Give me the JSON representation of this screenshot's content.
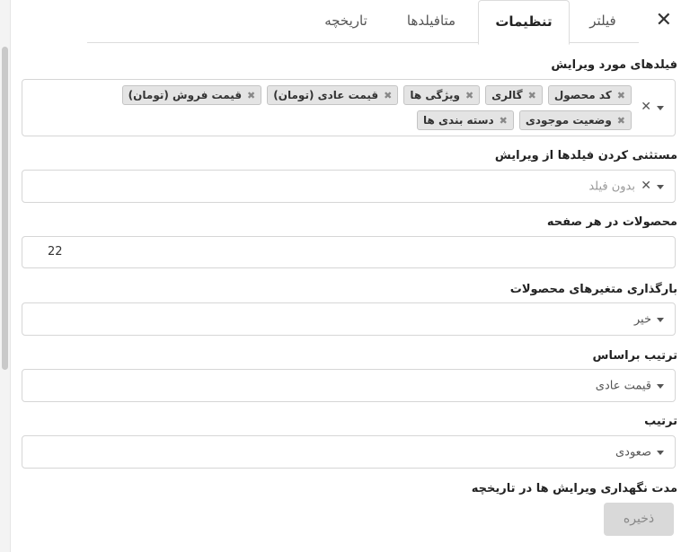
{
  "tabs": [
    {
      "label": "فیلتر"
    },
    {
      "label": "تنظیمات"
    },
    {
      "label": "متافیلدها"
    },
    {
      "label": "تاریخچه"
    }
  ],
  "close_symbol": "✕",
  "fields_to_edit": {
    "label": "فیلدهای مورد ویرایش",
    "chips_row1": [
      "کد محصول",
      "گالری",
      "ویژگی ها",
      "قیمت عادی (تومان)",
      "قیمت فروش (تومان)"
    ],
    "chips_row2": [
      "وضعیت موجودی",
      "دسته بندی ها"
    ],
    "chip_remove": "✖",
    "clear_symbol": "✕"
  },
  "exclude_fields": {
    "label": "مستثنی کردن فیلدها از ویرایش",
    "placeholder": "بدون فیلد",
    "clear_symbol": "✕"
  },
  "products_per_page": {
    "label": "محصولات در هر صفحه",
    "value": "22"
  },
  "load_variations": {
    "label": "بارگذاری متغیرهای محصولات",
    "value": "خیر"
  },
  "sort_by": {
    "label": "ترتیب براساس",
    "value": "قیمت عادی"
  },
  "order": {
    "label": "ترتیب",
    "value": "صعودی"
  },
  "history_retention": {
    "label": "مدت نگهداری ویرایش ها در تاریخچه"
  },
  "save_label": "ذخیره"
}
